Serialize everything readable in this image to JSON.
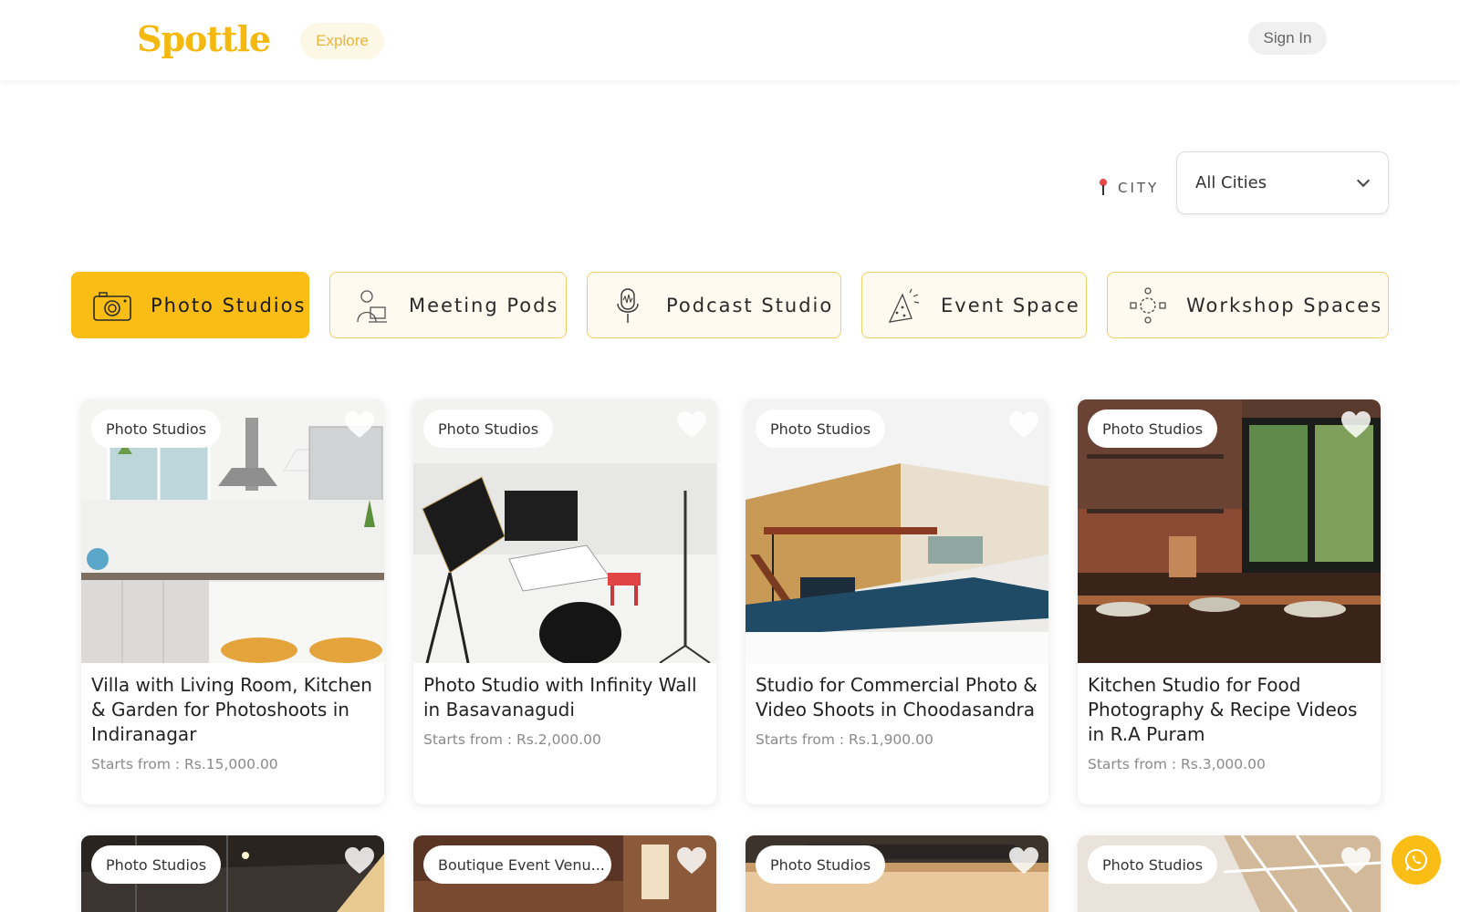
{
  "header": {
    "logo": "Spottle",
    "explore_label": "Explore",
    "signin_label": "Sign In"
  },
  "filter": {
    "city_label": "CITY",
    "city_value": "All Cities"
  },
  "categories": [
    {
      "label": "Photo Studios",
      "icon": "camera-icon",
      "active": true
    },
    {
      "label": "Meeting Pods",
      "icon": "meeting-person-icon",
      "active": false
    },
    {
      "label": "Podcast Studio",
      "icon": "microphone-icon",
      "active": false
    },
    {
      "label": "Event Space",
      "icon": "party-hat-icon",
      "active": false
    },
    {
      "label": "Workshop Spaces",
      "icon": "workshop-table-icon",
      "active": false
    }
  ],
  "cards": [
    {
      "badge": "Photo Studios",
      "title": "Villa with Living Room, Kitchen & Garden for Photoshoots in Indiranagar",
      "price": "Starts from : Rs.15,000.00"
    },
    {
      "badge": "Photo Studios",
      "title": "Photo Studio with Infinity Wall in Basavanagudi",
      "price": "Starts from : Rs.2,000.00"
    },
    {
      "badge": "Photo Studios",
      "title": "Studio for Commercial Photo & Video Shoots in Choodasandra",
      "price": "Starts from : Rs.1,900.00"
    },
    {
      "badge": "Photo Studios",
      "title": "Kitchen Studio for Food Photography & Recipe Videos in R.A Puram",
      "price": "Starts from : Rs.3,000.00"
    },
    {
      "badge": "Photo Studios"
    },
    {
      "badge": "Boutique Event Venu..."
    },
    {
      "badge": "Photo Studios"
    },
    {
      "badge": "Photo Studios"
    }
  ],
  "colors": {
    "brand": "#f9bd15",
    "accent_soft": "#fffaf0",
    "text_muted": "#8a8a8a"
  },
  "floating": {
    "icon": "whatsapp-icon"
  }
}
